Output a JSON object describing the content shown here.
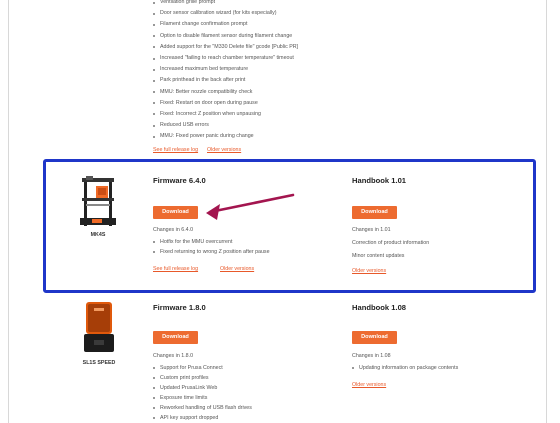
{
  "top_section": {
    "bullets": [
      "Ventilation grille prompt",
      "Door sensor calibration wizard (for kits especially)",
      "Filament change confirmation prompt",
      "Option to disable filament sensor during filament change",
      "Added support for the \"M330 Delete file\" gcode [Public PR]",
      "Increased \"failing to reach chamber temperature\" timeout",
      "Increased maximum bed temperature",
      "Park printhead in the back after print",
      "MMU: Better nozzle compatibility check",
      "Fixed: Restart on door open during pause",
      "Fixed: Incorrect Z position when unpausing",
      "Reduced USB errors",
      "MMU: Fixed power panic during change"
    ],
    "links": {
      "release_log": "See full release log",
      "older": "Older versions"
    }
  },
  "mk4s": {
    "product_name": "MK4S",
    "firmware": {
      "title": "Firmware 6.4.0",
      "download_label": "Download",
      "changes_heading": "Changes in 6.4.0",
      "changes": [
        "Hotfix for the MMU overcurrent",
        "Fixed returning to wrong Z position after pause"
      ],
      "release_log_link": "See full release log",
      "older_link": "Older versions"
    },
    "handbook": {
      "title": "Handbook 1.01",
      "download_label": "Download",
      "changes_heading": "Changes in 1.01",
      "changes": [
        "Correction of product information",
        "Minor content updates"
      ],
      "older_link": "Older versions"
    }
  },
  "sl1s": {
    "product_name": "SL1S SPEED",
    "firmware": {
      "title": "Firmware 1.8.0",
      "download_label": "Download",
      "changes_heading": "Changes in 1.8.0",
      "changes": [
        "Support for Prusa Connect",
        "Custom print profiles",
        "Updated PrusaLink Web",
        "Exposure time limits",
        "Reworked handling of USB flash drives",
        "API key support dropped"
      ]
    },
    "handbook": {
      "title": "Handbook 1.08",
      "download_label": "Download",
      "changes_heading": "Changes in 1.08",
      "changes": [
        "Updating information on package contents"
      ],
      "older_link": "Older versions"
    }
  },
  "colors": {
    "accent": "#ed6b30",
    "highlight_border": "#1f36c9",
    "arrow": "#a3154f"
  }
}
